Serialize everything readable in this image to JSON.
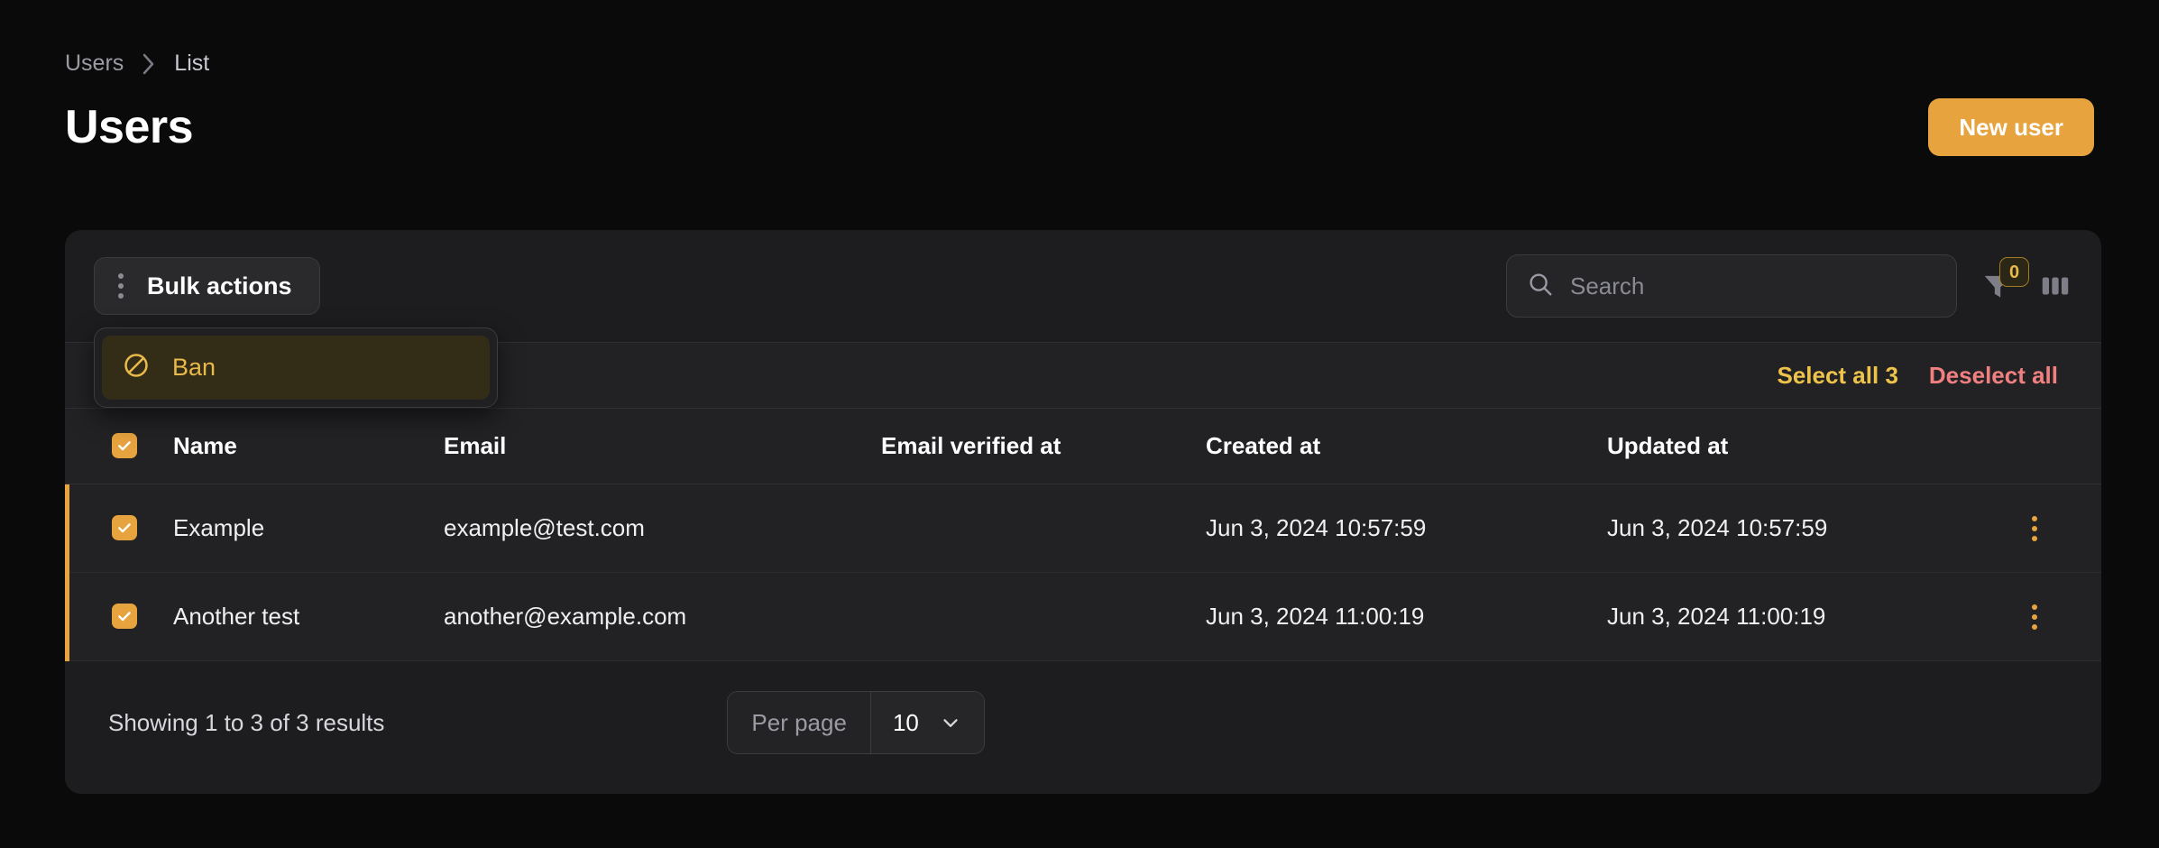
{
  "breadcrumb": {
    "parent": "Users",
    "separator": "›",
    "current": "List"
  },
  "header": {
    "title": "Users",
    "new_button": "New user"
  },
  "toolbar": {
    "bulk_actions_label": "Bulk actions",
    "kebab_icon": "vertical-dots-icon",
    "search_placeholder": "Search",
    "search_value": "",
    "search_icon": "search-icon",
    "filter_icon": "funnel-filter-icon",
    "filter_badge": "0",
    "columns_icon": "columns-icon"
  },
  "bulk_dropdown": {
    "items": [
      {
        "label": "Ban",
        "icon": "ban-circle-slash-icon"
      }
    ]
  },
  "selection_bar": {
    "select_all": "Select all 3",
    "deselect_all": "Deselect all"
  },
  "table": {
    "columns": [
      "Name",
      "Email",
      "Email verified at",
      "Created at",
      "Updated at"
    ],
    "header_checkbox_checked": true,
    "rows": [
      {
        "checked": true,
        "name": "Example",
        "email": "example@test.com",
        "email_verified_at": "",
        "created_at": "Jun 3, 2024 10:57:59",
        "updated_at": "Jun 3, 2024 10:57:59",
        "actions_icon": "vertical-dots-icon"
      },
      {
        "checked": true,
        "name": "Another test",
        "email": "another@example.com",
        "email_verified_at": "",
        "created_at": "Jun 3, 2024 11:00:19",
        "updated_at": "Jun 3, 2024 11:00:19",
        "actions_icon": "vertical-dots-icon"
      }
    ]
  },
  "footer": {
    "showing": "Showing 1 to 3 of 3 results",
    "per_page_label": "Per page",
    "per_page_value": "10",
    "chevron_icon": "chevron-down-icon"
  },
  "colors": {
    "page_bg": "#0a0a0b",
    "card_bg": "#1d1d1f",
    "row_bg": "#222225",
    "accent": "#e7a33e",
    "amber_text": "#edc34a",
    "danger": "#f08080"
  }
}
